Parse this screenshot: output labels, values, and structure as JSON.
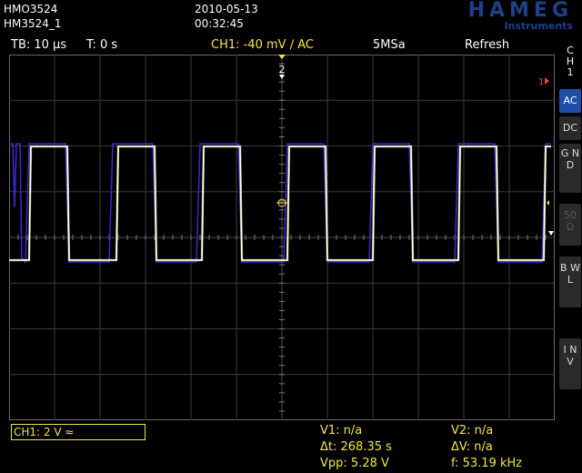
{
  "header": {
    "model": "HMO3524",
    "device_name": "HM3524_1",
    "date": "2010-05-13",
    "time": "00:32:45",
    "brand": "HAMEG",
    "brand_sub": "Instruments"
  },
  "status_bar": {
    "timebase": "TB: 10 µs",
    "trigger_time": "T: 0 s",
    "trigger": "CH1: -40 mV ∕ AC",
    "sample_rate": "5MSa",
    "mode": "Refresh"
  },
  "side_menu": {
    "channel_label_1": "C",
    "channel_label_2": "H",
    "channel_label_3": "1",
    "buttons": [
      {
        "label": "AC",
        "state": "active"
      },
      {
        "label": "DC",
        "state": "normal"
      },
      {
        "label": "G N D",
        "state": "normal"
      },
      {
        "label": "50 Ω",
        "state": "dim"
      },
      {
        "label": "B W L",
        "state": "normal"
      },
      {
        "label": "I N V",
        "state": "normal"
      }
    ]
  },
  "markers": {
    "trigger_pos": "2",
    "ch1_right": "1",
    "ch1_left": "1"
  },
  "bottom_bar": {
    "channel_setting": "CH1: 2 V ≈",
    "v1": "V1: n/a",
    "v2": "V2: n/a",
    "dt": "Δt: 268.35 s",
    "dv": "ΔV: n/a",
    "vpp": "Vpp: 5.28 V",
    "freq": "f: 53.19 kHz"
  },
  "colors": {
    "accent": "#f4e64a",
    "brand": "#1f3f8a",
    "ch1_trace": "#ffffff",
    "ref_trace": "#3a2ad0",
    "active_button": "#1e4fa8"
  }
}
